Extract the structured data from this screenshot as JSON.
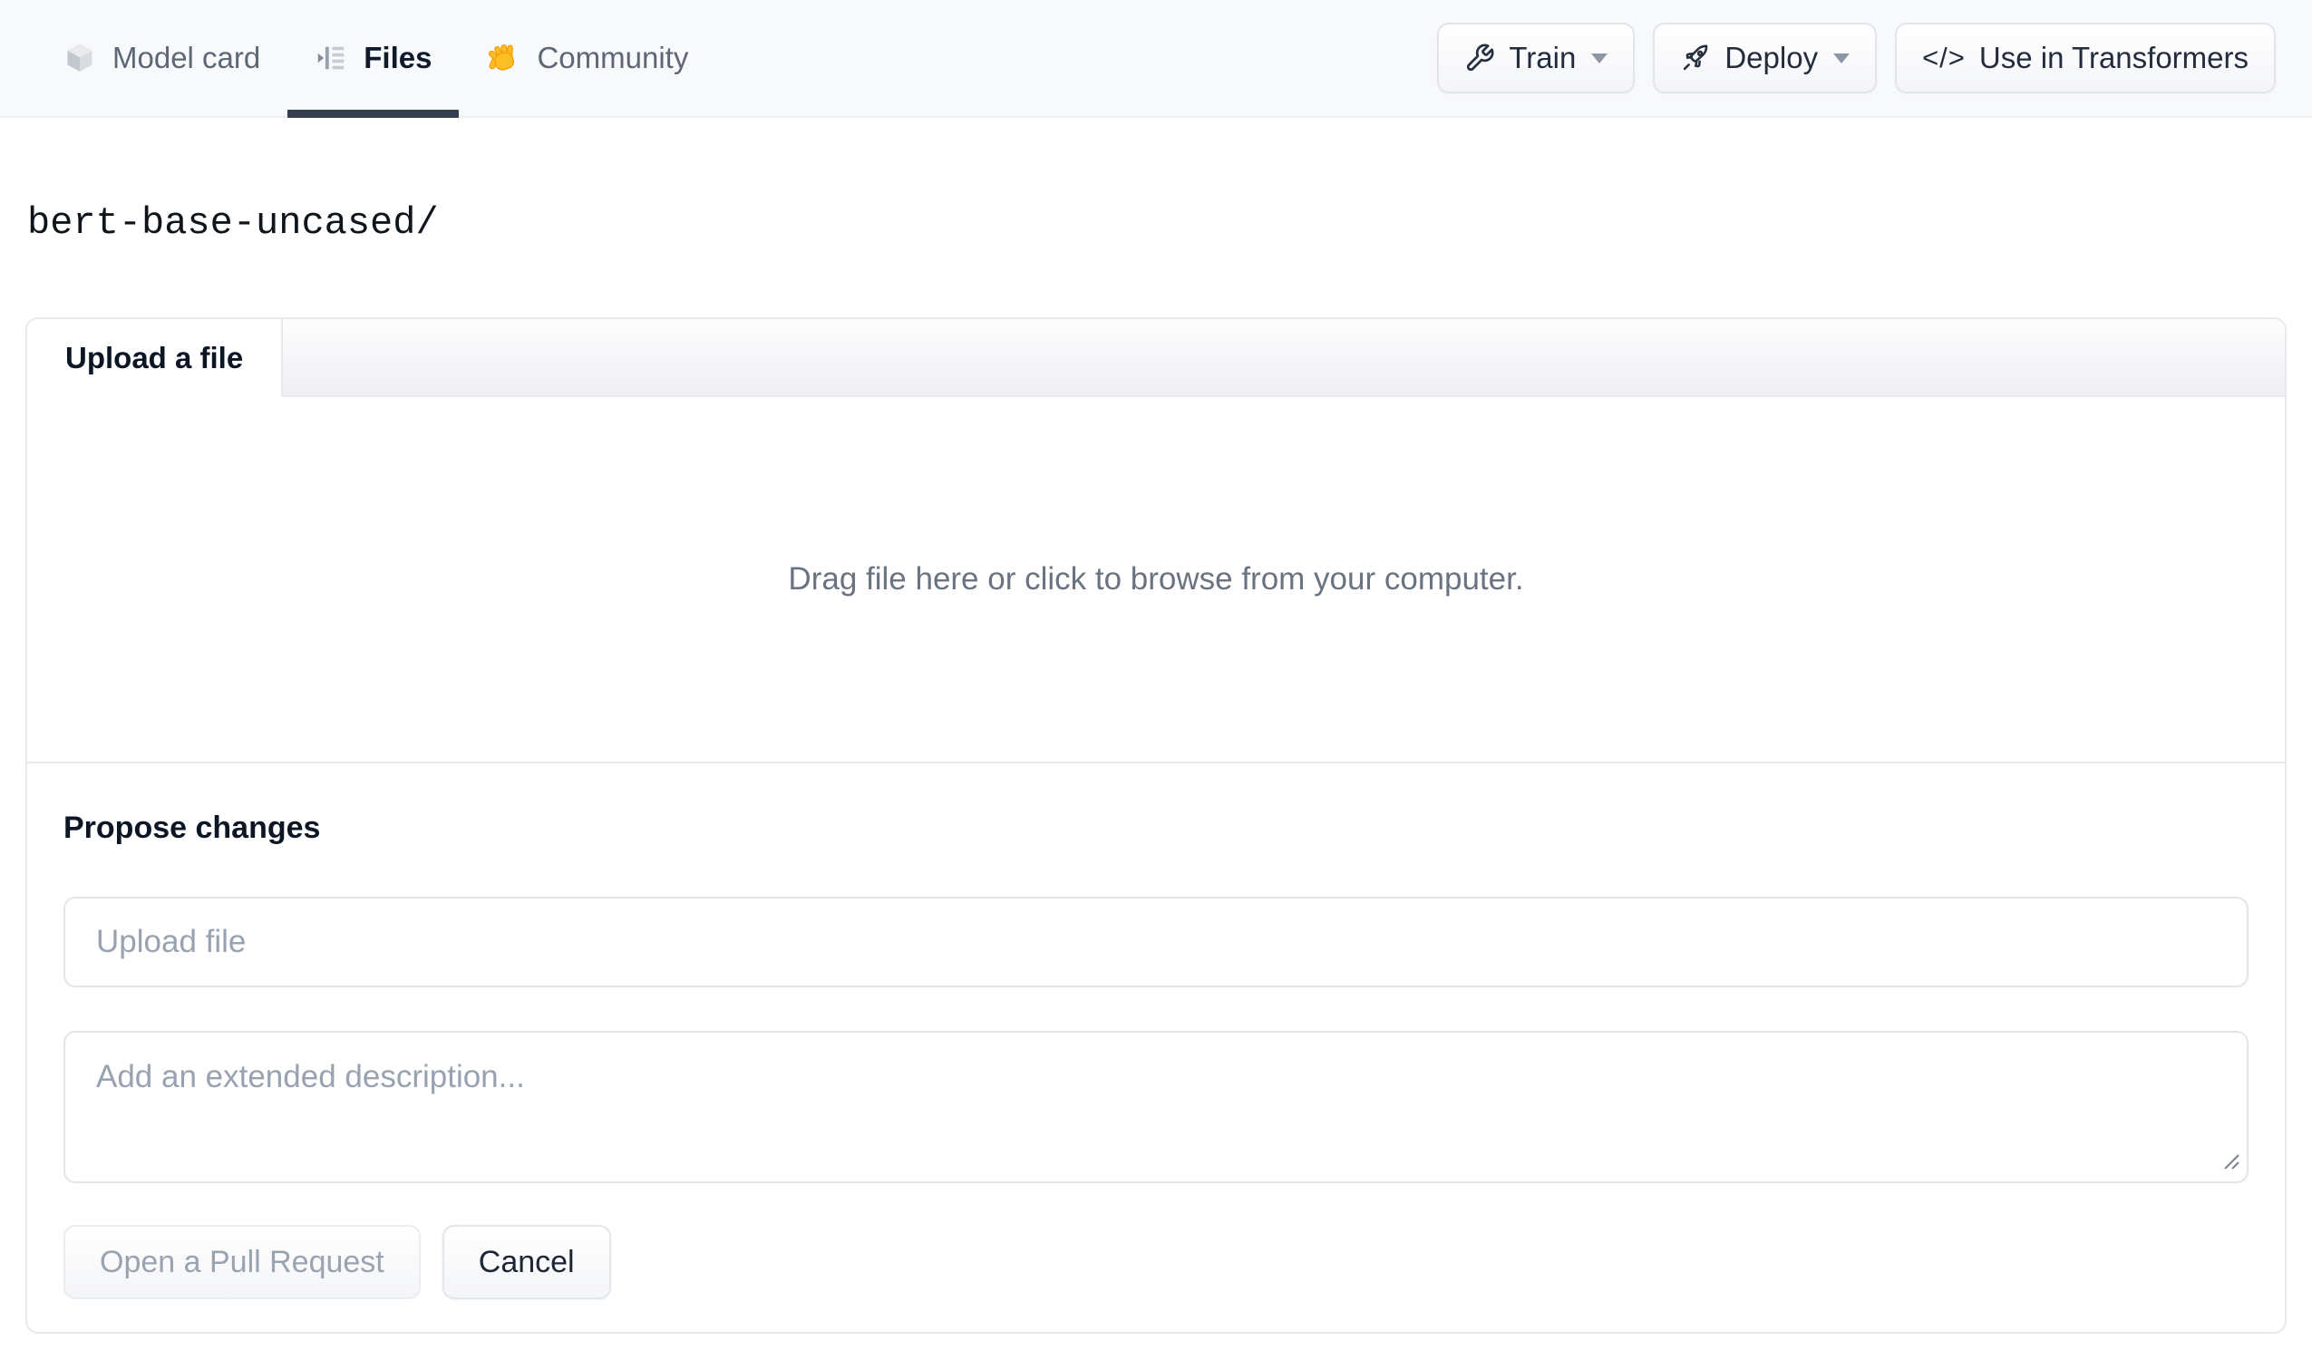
{
  "header": {
    "nav": [
      {
        "label": "Model card"
      },
      {
        "label": "Files"
      },
      {
        "label": "Community"
      }
    ],
    "actions": {
      "train_label": "Train",
      "deploy_label": "Deploy",
      "transformers_label": "Use in Transformers",
      "code_glyph": "</>"
    }
  },
  "breadcrumb": {
    "repo_path": "bert-base-uncased/"
  },
  "panel": {
    "tab_label": "Upload a file",
    "dropzone_text": "Drag file here or click to browse from your computer.",
    "propose_heading": "Propose changes",
    "file_input_placeholder": "Upload file",
    "description_placeholder": "Add an extended description...",
    "open_pr_label": "Open a Pull Request",
    "cancel_label": "Cancel"
  },
  "colors": {
    "header_bg": "#f8f9fb",
    "active_underline": "#333e4e",
    "panel_border": "#e7e9ed",
    "muted_text": "#6a7381",
    "placeholder_text": "#99a2b1",
    "hand_color": "#fbbf24"
  }
}
